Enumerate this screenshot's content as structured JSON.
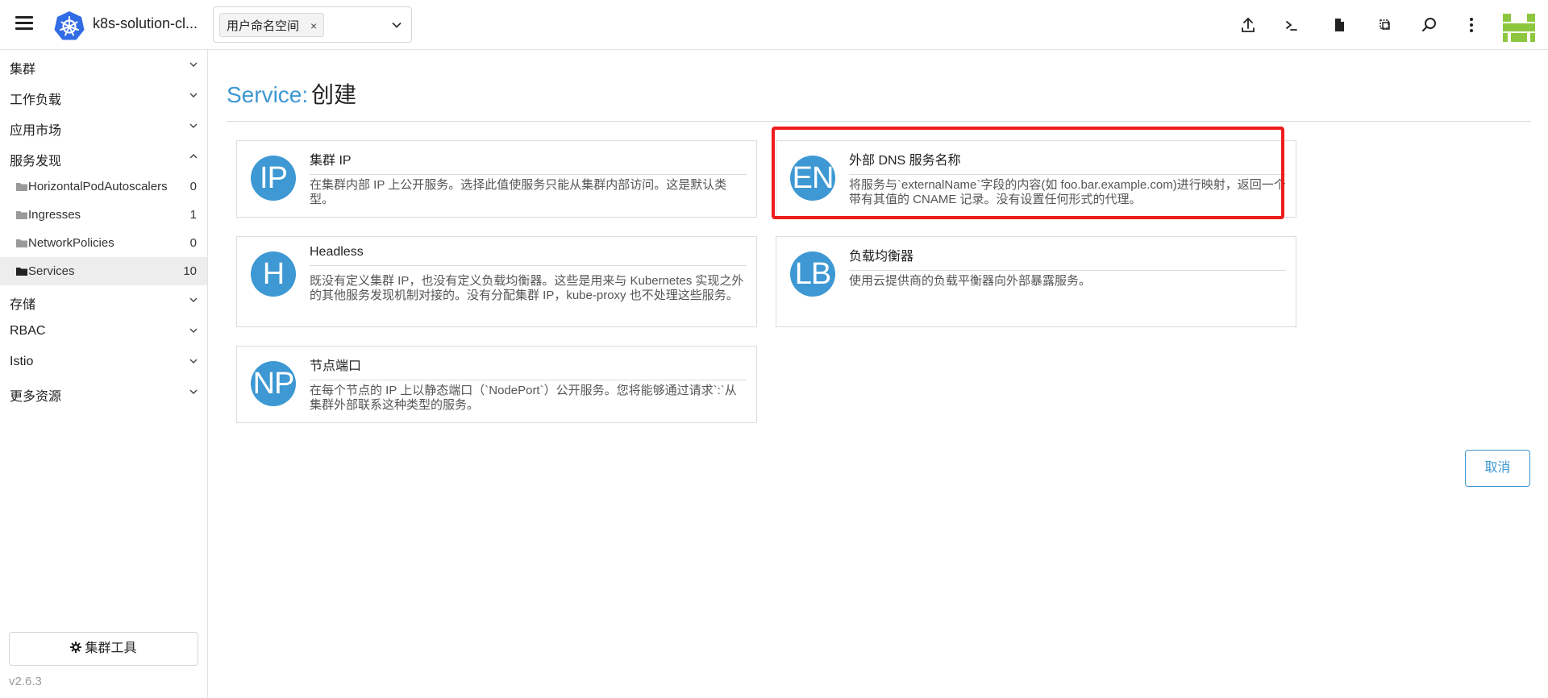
{
  "header": {
    "cluster_name": "k8s-solution-cl...",
    "namespace_chip": "用户命名空间",
    "chip_remove": "×",
    "icons": [
      "upload-icon",
      "terminal-icon",
      "file-icon",
      "copy-config-icon",
      "search-icon",
      "more-vertical-icon"
    ],
    "avatar_color": "#8dc63f"
  },
  "sidebar": {
    "groups_top": [
      {
        "label": "集群",
        "expanded": false
      },
      {
        "label": "工作负载",
        "expanded": false
      },
      {
        "label": "应用市场",
        "expanded": false
      },
      {
        "label": "服务发现",
        "expanded": true
      }
    ],
    "children": [
      {
        "label": "HorizontalPodAutoscalers",
        "count": "0",
        "active": false
      },
      {
        "label": "Ingresses",
        "count": "1",
        "active": false
      },
      {
        "label": "NetworkPolicies",
        "count": "0",
        "active": false
      },
      {
        "label": "Services",
        "count": "10",
        "active": true
      }
    ],
    "groups_bottom": [
      {
        "label": "存储",
        "expanded": false
      },
      {
        "label": "RBAC",
        "expanded": false
      },
      {
        "label": "Istio",
        "expanded": false
      },
      {
        "label": "更多资源",
        "expanded": false
      }
    ],
    "tools_label": "集群工具",
    "version": "v2.6.3"
  },
  "main": {
    "resource": "Service:",
    "action": "创建",
    "cards": [
      {
        "badge": "IP",
        "title": "集群 IP",
        "desc": "在集群内部 IP 上公开服务。选择此值使服务只能从集群内部访问。这是默认类型。"
      },
      {
        "badge": "EN",
        "title": "外部 DNS 服务名称",
        "desc": "将服务与`externalName`字段的内容(如 foo.bar.example.com)进行映射，返回一个带有其值的 CNAME 记录。没有设置任何形式的代理。"
      },
      {
        "badge": "H",
        "title": "Headless",
        "desc": "既没有定义集群 IP，也没有定义负载均衡器。这些是用来与 Kubernetes 实现之外的其他服务发现机制对接的。没有分配集群 IP，kube-proxy 也不处理这些服务。"
      },
      {
        "badge": "LB",
        "title": "负载均衡器",
        "desc": "使用云提供商的负载平衡器向外部暴露服务。"
      },
      {
        "badge": "NP",
        "title": "节点端口",
        "desc": "在每个节点的 IP 上以静态端口（`NodePort`）公开服务。您将能够通过请求`:`从集群外部联系这种类型的服务。"
      }
    ],
    "cancel_label": "取消",
    "accent_color": "#3d98d3",
    "highlight_color": "#ee1c1c"
  }
}
